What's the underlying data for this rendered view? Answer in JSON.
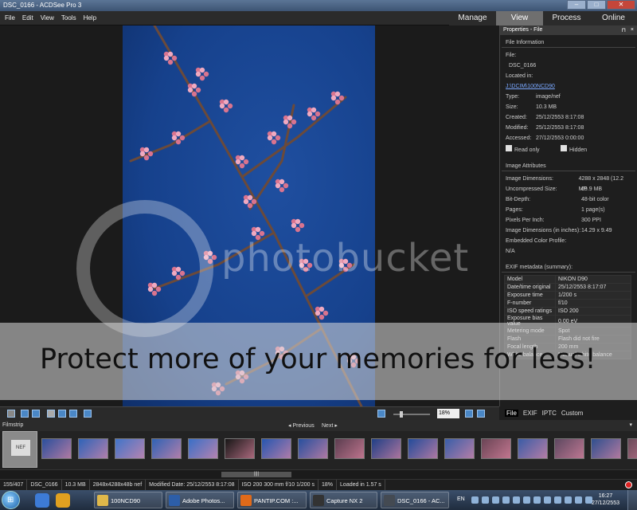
{
  "window": {
    "title": "DSC_0166 - ACDSee Pro 3",
    "controls": [
      "–",
      "□",
      "✕"
    ]
  },
  "menu": {
    "items": [
      "File",
      "Edit",
      "View",
      "Tools",
      "Help"
    ]
  },
  "modes": {
    "tabs": [
      "Manage",
      "View",
      "Process",
      "Online"
    ],
    "active": "View"
  },
  "properties": {
    "header": "Properties - File",
    "pin": "⊓",
    "close": "×",
    "file_info": {
      "title": "File Information",
      "file_label": "File:",
      "file_value": "DSC_0166",
      "located_label": "Located in:",
      "located_value": "J:\\DCIM\\100NCD90",
      "rows": [
        {
          "k": "Type:",
          "v": "image/nef"
        },
        {
          "k": "Size:",
          "v": "10.3 MB"
        },
        {
          "k": "Created:",
          "v": "25/12/2553 8:17:08"
        },
        {
          "k": "Modified:",
          "v": "25/12/2553 8:17:08"
        },
        {
          "k": "Accessed:",
          "v": "27/12/2553 0:00:00"
        }
      ],
      "readonly": "Read only",
      "hidden": "Hidden"
    },
    "image_attr": {
      "title": "Image Attributes",
      "rows": [
        {
          "k": "Image Dimensions:",
          "v": "4288 x 2848 (12.2 MP"
        },
        {
          "k": "Uncompressed Size:",
          "v": "69.9 MB"
        },
        {
          "k": "Bit-Depth:",
          "v": "48-bit color"
        },
        {
          "k": "Pages:",
          "v": "1 page(s)"
        },
        {
          "k": "Pixels Per Inch:",
          "v": "300 PPI"
        },
        {
          "k": "Image Dimensions (in inches):",
          "v": "14.29 x 9.49"
        }
      ],
      "color_profile_label": "Embedded Color Profile:",
      "color_profile_value": "N/A"
    },
    "exif": {
      "title": "EXIF metadata (summary):",
      "rows": [
        {
          "k": "Model",
          "v": "NIKON D90"
        },
        {
          "k": "Date/time original",
          "v": "25/12/2553 8:17:07"
        },
        {
          "k": "Exposure time",
          "v": "1/200 s"
        },
        {
          "k": "F-number",
          "v": "f/10"
        },
        {
          "k": "ISO speed ratings",
          "v": "ISO 200"
        },
        {
          "k": "Exposure bias value",
          "v": "0.00 eV"
        },
        {
          "k": "Metering mode",
          "v": "Spot"
        },
        {
          "k": "Flash",
          "v": "Flash did not fire"
        },
        {
          "k": "Focal length",
          "v": "200 mm"
        },
        {
          "k": "White balance",
          "v": "Manual white balance"
        }
      ]
    },
    "tabs": [
      "File",
      "EXIF",
      "IPTC",
      "Custom"
    ],
    "active_tab": "File"
  },
  "viewer_toolbar": {
    "zoom": "18%",
    "zoom_fraction": 0.18
  },
  "filmstrip": {
    "label": "Filmstrip",
    "prev": "◂ Previous",
    "next": "Next ▸",
    "selected_icon_text": "NEF",
    "thumb_colors": [
      "#2a4f9c",
      "#2f63b8",
      "#4174c9",
      "#2f62b5",
      "#3a6fc7",
      "#161616",
      "#2656b0",
      "#274f9e",
      "#5b3d4f",
      "#1f3f86",
      "#234b9a",
      "#3a5ea9",
      "#6a4455",
      "#3b5ca6",
      "#5d4860",
      "#2f4f8e",
      "#6a4a59"
    ]
  },
  "scrollbar": {
    "thumb_label": "||||"
  },
  "status": {
    "index": "155/407",
    "name": "DSC_0166",
    "size": "10.3 MB",
    "dims": "2848x4288x48b nef",
    "modified": "Modified Date: 25/12/2553 8:17:08",
    "exposure": "ISO 200   300 mm   f/10   1/200 s",
    "zoom": "18%",
    "loaded": "Loaded in 1.57 s"
  },
  "taskbar": {
    "start": "⊞",
    "tasks": [
      "100NCD90",
      "Adobe Photos...",
      "PANTIP.COM :...",
      "Capture NX 2",
      "DSC_0166 - AC..."
    ],
    "task_colors": [
      "#e0b84a",
      "#2d5ea8",
      "#e06a1a",
      "#333333",
      "#444a52"
    ],
    "quicklaunch_colors": [
      "#3d7bd6",
      "#e0a020"
    ],
    "lang": "EN",
    "time": "16:27",
    "date": "27/12/2553"
  },
  "watermark": {
    "logo": "photobucket",
    "band": "Protect more of your memories for less!"
  }
}
